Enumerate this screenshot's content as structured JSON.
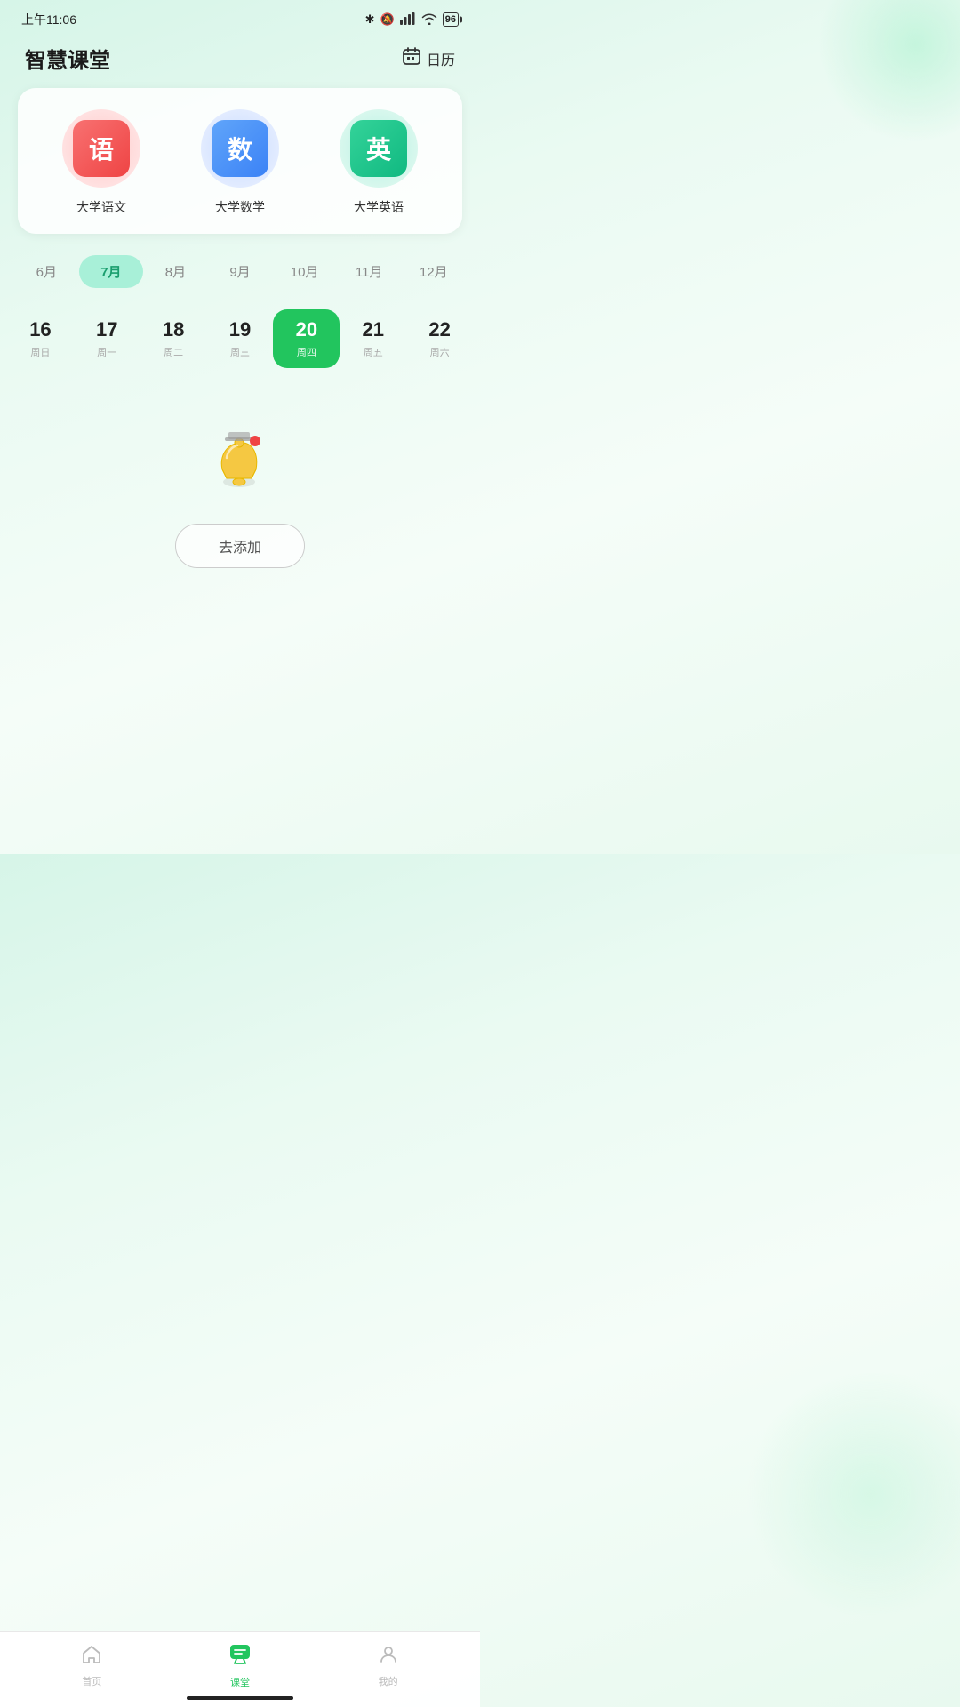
{
  "statusBar": {
    "time": "上午11:06",
    "battery": "96"
  },
  "header": {
    "title": "智慧课堂",
    "calendarIcon": "calendar-icon",
    "calendarLabel": "日历"
  },
  "subjects": [
    {
      "id": "chinese",
      "icon": "语",
      "name": "大学语文",
      "style": "chinese"
    },
    {
      "id": "math",
      "icon": "数",
      "name": "大学数学",
      "style": "math"
    },
    {
      "id": "english",
      "icon": "英",
      "name": "大学英语",
      "style": "english"
    }
  ],
  "months": [
    {
      "label": "6月",
      "active": false
    },
    {
      "label": "7月",
      "active": true
    },
    {
      "label": "8月",
      "active": false
    },
    {
      "label": "9月",
      "active": false
    },
    {
      "label": "10月",
      "active": false
    },
    {
      "label": "11月",
      "active": false
    },
    {
      "label": "12月",
      "active": false
    }
  ],
  "dates": [
    {
      "number": "16",
      "weekday": "周日",
      "active": false
    },
    {
      "number": "17",
      "weekday": "周一",
      "active": false
    },
    {
      "number": "18",
      "weekday": "周二",
      "active": false
    },
    {
      "number": "19",
      "weekday": "周三",
      "active": false
    },
    {
      "number": "20",
      "weekday": "周四",
      "active": true
    },
    {
      "number": "21",
      "weekday": "周五",
      "active": false
    },
    {
      "number": "22",
      "weekday": "周六",
      "active": false
    }
  ],
  "emptyState": {
    "bellEmoji": "🔔",
    "addButtonLabel": "去添加"
  },
  "bottomNav": [
    {
      "id": "home",
      "icon": "🏠",
      "label": "首页",
      "active": false
    },
    {
      "id": "classroom",
      "icon": "💬",
      "label": "课堂",
      "active": true
    },
    {
      "id": "mine",
      "icon": "👤",
      "label": "我的",
      "active": false
    }
  ]
}
